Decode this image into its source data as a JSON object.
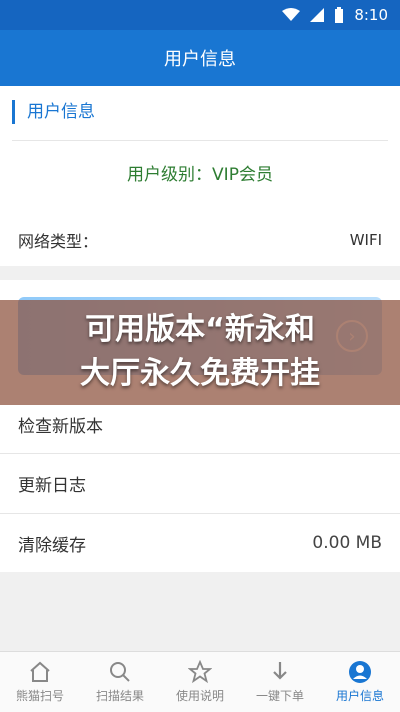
{
  "status_bar": {
    "time": "8:10"
  },
  "app_bar": {
    "title": "用户信息"
  },
  "user_section": {
    "title": "用户信息",
    "level_text": "用户级别：VIP会员",
    "network_label": "网络类型：",
    "network_value": "WIFI"
  },
  "overlay": {
    "line1": "可用版本“新永和",
    "line2": "大厅永久免费开挂"
  },
  "menu": {
    "check_update": "检查新版本",
    "changelog": "更新日志",
    "clear_cache": "清除缓存",
    "cache_size": "0.00 MB"
  },
  "tabs": [
    {
      "label": "熊猫扫号",
      "icon": "home-icon"
    },
    {
      "label": "扫描结果",
      "icon": "search-icon"
    },
    {
      "label": "使用说明",
      "icon": "star-icon"
    },
    {
      "label": "一键下单",
      "icon": "download-icon"
    },
    {
      "label": "用户信息",
      "icon": "user-icon"
    }
  ],
  "colors": {
    "primary": "#1976d2",
    "level_green": "#2e7d32"
  }
}
